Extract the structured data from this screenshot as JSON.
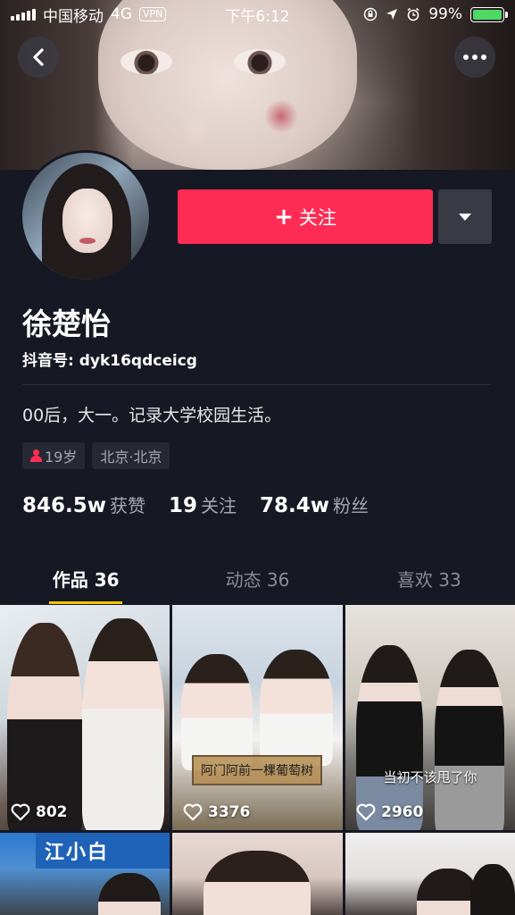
{
  "status_bar": {
    "carrier": "中国移动",
    "network": "4G",
    "vpn": "VPN",
    "time": "下午6:12",
    "battery": "99%",
    "battery_level": 0.99
  },
  "profile": {
    "follow_label": "关注",
    "name": "徐楚怡",
    "douyin_id": "抖音号: dyk16qdceicg",
    "bio": "00后，大一。记录大学校园生活。",
    "tags": {
      "age": "19岁",
      "location": "北京·北京"
    },
    "stats": {
      "likes_num": "846.5w",
      "likes_label": "获赞",
      "following_num": "19",
      "following_label": "关注",
      "followers_num": "78.4w",
      "followers_label": "粉丝"
    }
  },
  "tabs": [
    {
      "label": "作品 36",
      "active": true
    },
    {
      "label": "动态 36",
      "active": false
    },
    {
      "label": "喜欢 33",
      "active": false
    }
  ],
  "videos": [
    {
      "likes": "802",
      "subtitle": ""
    },
    {
      "likes": "3376",
      "subtitle": "阿门阿前一棵葡萄树"
    },
    {
      "likes": "2960",
      "subtitle": "当初不该甩了你"
    }
  ],
  "video_partial_signs": {
    "shop_sign": "江小白"
  },
  "colors": {
    "accent": "#fe2c55",
    "background": "#161823",
    "tab_indicator": "#f5c400"
  },
  "icons": [
    "back-arrow-icon",
    "more-dots-icon",
    "dropdown-triangle-icon",
    "person-icon",
    "heart-icon",
    "lock-rotation-icon",
    "location-icon",
    "alarm-icon"
  ]
}
